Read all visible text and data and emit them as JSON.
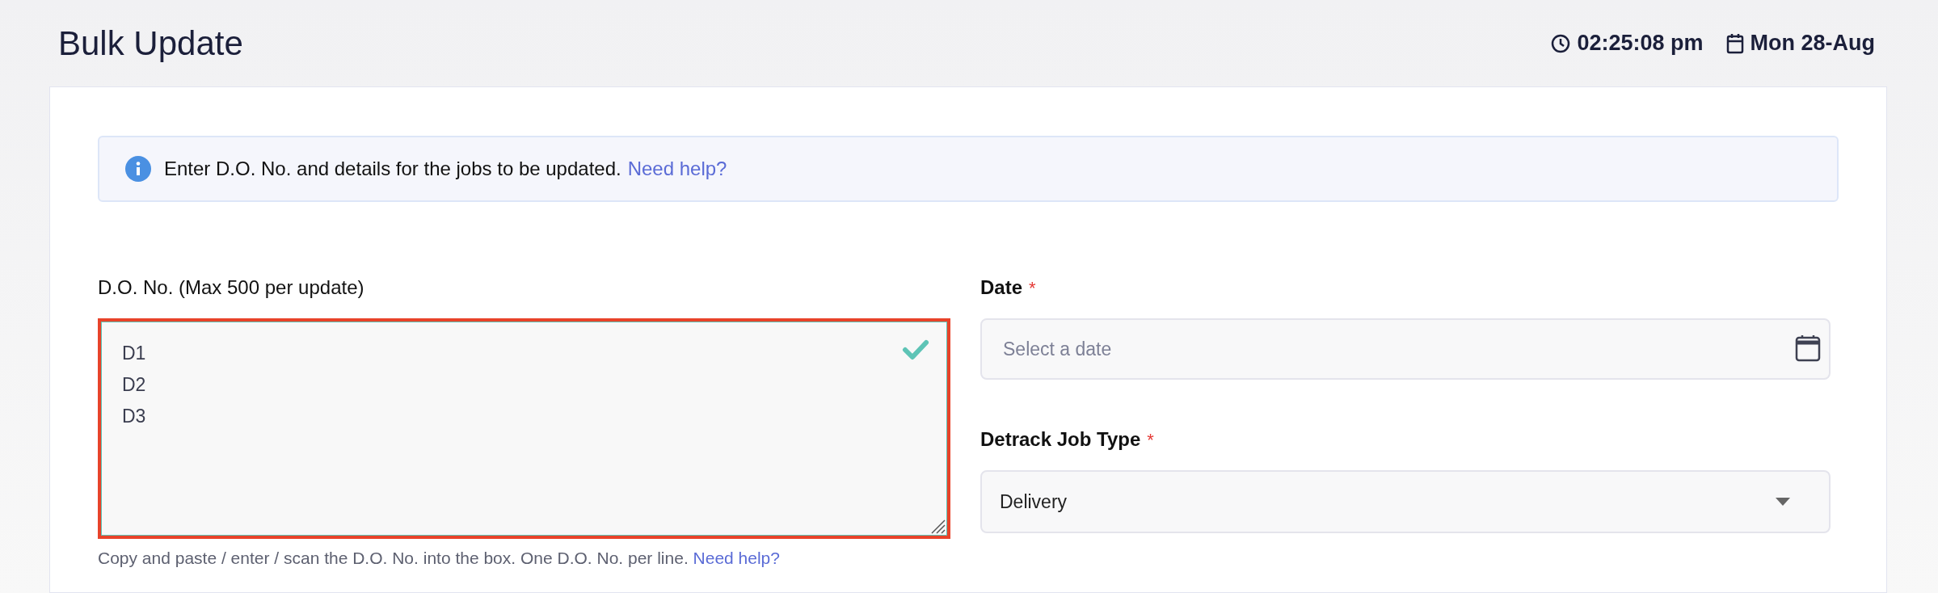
{
  "header": {
    "title": "Bulk Update",
    "time": "02:25:08 pm",
    "date": "Mon 28-Aug"
  },
  "info_banner": {
    "text": "Enter D.O. No. and details for the jobs to be updated.",
    "link": "Need help?"
  },
  "do_numbers": {
    "label": "D.O. No. (Max 500 per update)",
    "value": [
      "D1",
      "D2",
      "D3"
    ],
    "valid": true,
    "highlighted": true,
    "hint": "Copy and paste / enter / scan the D.O. No. into the box. One D.O. No. per line.",
    "hint_link": "Need help?"
  },
  "date": {
    "label": "Date",
    "required_mark": "*",
    "placeholder": "Select a date"
  },
  "job_type": {
    "label": "Detrack Job Type",
    "required_mark": "*",
    "value": "Delivery"
  }
}
